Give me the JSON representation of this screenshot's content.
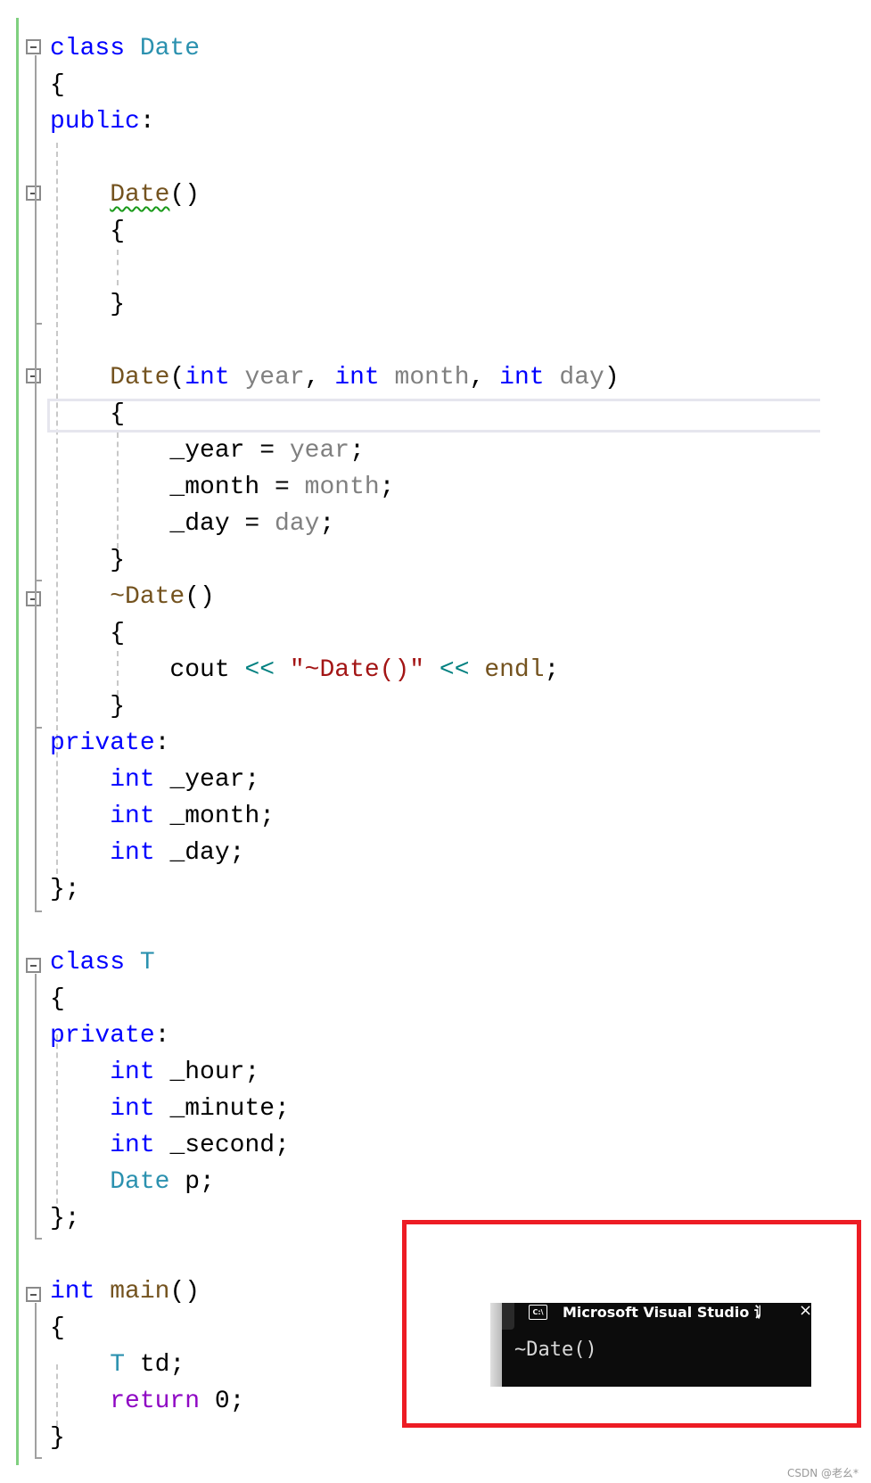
{
  "editor": {
    "lines": [
      [
        [
          "class ",
          "kw"
        ],
        [
          "Date",
          "ty"
        ]
      ],
      [
        [
          "{",
          "pl"
        ]
      ],
      [
        [
          "public",
          "kw"
        ],
        [
          ":",
          "pl"
        ]
      ],
      [],
      [
        [
          "    ",
          "pl"
        ],
        [
          "Date",
          "fn squiggle"
        ],
        [
          "()",
          "pl"
        ]
      ],
      [
        [
          "    {",
          "pl"
        ]
      ],
      [],
      [
        [
          "    }",
          "pl"
        ]
      ],
      [],
      [
        [
          "    ",
          "pl"
        ],
        [
          "Date",
          "fn"
        ],
        [
          "(",
          "pl"
        ],
        [
          "int",
          "kw"
        ],
        [
          " ",
          "pl"
        ],
        [
          "year",
          "pa"
        ],
        [
          ", ",
          "pl"
        ],
        [
          "int",
          "kw"
        ],
        [
          " ",
          "pl"
        ],
        [
          "month",
          "pa"
        ],
        [
          ", ",
          "pl"
        ],
        [
          "int",
          "kw"
        ],
        [
          " ",
          "pl"
        ],
        [
          "day",
          "pa"
        ],
        [
          ")",
          "pl"
        ]
      ],
      [
        [
          "    {",
          "pl"
        ]
      ],
      [
        [
          "        _year = ",
          "pl"
        ],
        [
          "year",
          "pa"
        ],
        [
          ";",
          "pl"
        ]
      ],
      [
        [
          "        _month = ",
          "pl"
        ],
        [
          "month",
          "pa"
        ],
        [
          ";",
          "pl"
        ]
      ],
      [
        [
          "        _day = ",
          "pl"
        ],
        [
          "day",
          "pa"
        ],
        [
          ";",
          "pl"
        ]
      ],
      [
        [
          "    }",
          "pl"
        ]
      ],
      [
        [
          "    ",
          "pl"
        ],
        [
          "~Date",
          "fn"
        ],
        [
          "()",
          "pl"
        ]
      ],
      [
        [
          "    {",
          "pl"
        ]
      ],
      [
        [
          "        cout ",
          "pl"
        ],
        [
          "<<",
          "op"
        ],
        [
          " ",
          "pl"
        ],
        [
          "\"~Date()\"",
          "st"
        ],
        [
          " ",
          "pl"
        ],
        [
          "<<",
          "op"
        ],
        [
          " ",
          "pl"
        ],
        [
          "endl",
          "fn"
        ],
        [
          ";",
          "pl"
        ]
      ],
      [
        [
          "    }",
          "pl"
        ]
      ],
      [
        [
          "private",
          "kw"
        ],
        [
          ":",
          "pl"
        ]
      ],
      [
        [
          "    ",
          "pl"
        ],
        [
          "int",
          "kw"
        ],
        [
          " _year;",
          "pl"
        ]
      ],
      [
        [
          "    ",
          "pl"
        ],
        [
          "int",
          "kw"
        ],
        [
          " _month;",
          "pl"
        ]
      ],
      [
        [
          "    ",
          "pl"
        ],
        [
          "int",
          "kw"
        ],
        [
          " _day;",
          "pl"
        ]
      ],
      [
        [
          "};",
          "pl"
        ]
      ],
      [],
      [
        [
          "class ",
          "kw"
        ],
        [
          "T",
          "ty"
        ]
      ],
      [
        [
          "{",
          "pl"
        ]
      ],
      [
        [
          "private",
          "kw"
        ],
        [
          ":",
          "pl"
        ]
      ],
      [
        [
          "    ",
          "pl"
        ],
        [
          "int",
          "kw"
        ],
        [
          " _hour;",
          "pl"
        ]
      ],
      [
        [
          "    ",
          "pl"
        ],
        [
          "int",
          "kw"
        ],
        [
          " _minute;",
          "pl"
        ]
      ],
      [
        [
          "    ",
          "pl"
        ],
        [
          "int",
          "kw"
        ],
        [
          " _second;",
          "pl"
        ]
      ],
      [
        [
          "    ",
          "pl"
        ],
        [
          "Date",
          "ty"
        ],
        [
          " p;",
          "pl"
        ]
      ],
      [
        [
          "};",
          "pl"
        ]
      ],
      [],
      [
        [
          "int",
          "kw"
        ],
        [
          " ",
          "pl"
        ],
        [
          "main",
          "fn"
        ],
        [
          "()",
          "pl"
        ]
      ],
      [
        [
          "{",
          "pl"
        ]
      ],
      [
        [
          "    ",
          "pl"
        ],
        [
          "T",
          "ty"
        ],
        [
          " td;",
          "pl"
        ]
      ],
      [
        [
          "    ",
          "pl"
        ],
        [
          "return",
          "rt"
        ],
        [
          " 0;",
          "pl"
        ]
      ],
      [
        [
          "}",
          "pl"
        ]
      ]
    ]
  },
  "console": {
    "icon_label": "C:\\",
    "title": "Microsoft Visual Studio 调试控制台",
    "close_icon": "×",
    "output": "~Date()"
  },
  "colors": {
    "highlight_box": "#ed1c24",
    "keyword": "#0000ff",
    "type": "#2b91af"
  },
  "watermark": "CSDN @老幺*"
}
